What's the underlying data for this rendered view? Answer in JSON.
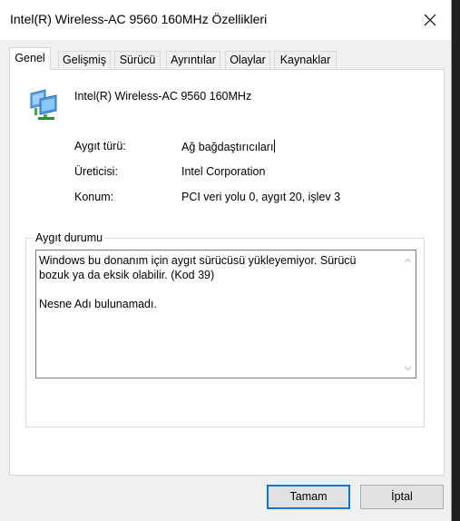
{
  "window": {
    "title": "Intel(R) Wireless-AC 9560 160MHz Özellikleri"
  },
  "tabs": [
    {
      "label": "Genel",
      "active": true
    },
    {
      "label": "Gelişmiş"
    },
    {
      "label": "Sürücü"
    },
    {
      "label": "Ayrıntılar"
    },
    {
      "label": "Olaylar"
    },
    {
      "label": "Kaynaklar"
    }
  ],
  "device": {
    "icon": "network-adapter-icon",
    "name": "Intel(R) Wireless-AC 9560 160MHz"
  },
  "properties": [
    {
      "label": "Aygıt türü:",
      "value": "Ağ bağdaştırıcıları"
    },
    {
      "label": "Üreticisi:",
      "value": "Intel Corporation"
    },
    {
      "label": "Konum:",
      "value": "PCI veri yolu 0, aygıt 20, işlev 3"
    }
  ],
  "status": {
    "group_title": "Aygıt durumu",
    "text": "Windows bu donanım için aygıt sürücüsü yükleyemiyor. Sürücü\nbozuk ya da eksik olabilir. (Kod 39)\n\nNesne Adı bulunamadı."
  },
  "buttons": {
    "ok": "Tamam",
    "cancel": "İptal"
  },
  "colors": {
    "accent": "#0078d7",
    "dialog_bg": "#f0f0f0",
    "panel_bg": "#ffffff"
  }
}
